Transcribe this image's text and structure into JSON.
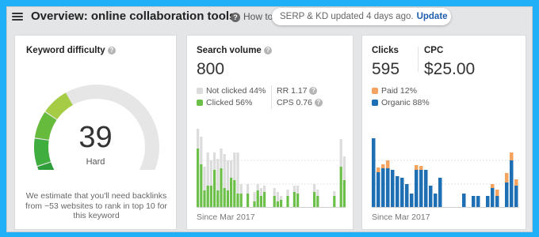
{
  "header": {
    "title": "Overview: online collaboration tools",
    "how_to": "How to",
    "help_glyph": "?",
    "notice_text": "SERP & KD updated 4 days ago.",
    "update_label": "Update"
  },
  "keyword_difficulty": {
    "title": "Keyword difficulty",
    "value": "39",
    "value_fraction": 0.39,
    "label": "Hard",
    "description": "We estimate that you'll need backlinks from ~53 websites to rank in top 10 for this keyword"
  },
  "search_volume": {
    "title": "Search volume",
    "value": "800",
    "legend_not_clicked": "Not clicked 44%",
    "legend_clicked": "Clicked 56%",
    "rr": "RR 1.17",
    "cps": "CPS 0.76",
    "since": "Since Mar 2017"
  },
  "clicks": {
    "title": "Clicks",
    "value": "595",
    "cpc_title": "CPC",
    "cpc_value": "$25.00",
    "legend_paid": "Paid 12%",
    "legend_organic": "Organic 88%",
    "since": "Since Mar 2017"
  },
  "colors": {
    "background": "#1fb0f7",
    "clicked": "#6cc04a",
    "not_clicked": "#dcdcdc",
    "organic": "#1f6fb5",
    "paid": "#f4a460",
    "kd_gauge_fill": "#3fae3f"
  },
  "chart_data": [
    {
      "type": "bar",
      "series": [
        {
          "name": "Clicked",
          "values": [
            0.75,
            0.55,
            0.22,
            0.28,
            0.28,
            0.48,
            0.22,
            0.5,
            0.25,
            0.22,
            0.38,
            0.35,
            0.18,
            0.18,
            0.0,
            0.18,
            0.0,
            0.08,
            0.22,
            0.15,
            0.2,
            0.0,
            0.0,
            0.15,
            0.08,
            0.1,
            0.0,
            0.15,
            0.0,
            0.2,
            0.18,
            0.0,
            0.0,
            0.0,
            0.0,
            0.2,
            0.15,
            0.0,
            0.0,
            0.0,
            0.0,
            0.15,
            0.0,
            0.52,
            0.35
          ]
        },
        {
          "name": "Not clicked",
          "values": [
            0.25,
            0.35,
            0.3,
            0.42,
            0.32,
            0.22,
            0.4,
            0.25,
            0.43,
            0.38,
            0.22,
            0.35,
            0.52,
            0.12,
            0.0,
            0.12,
            0.0,
            0.12,
            0.08,
            0.1,
            0.08,
            0.0,
            0.0,
            0.1,
            0.12,
            0.05,
            0.0,
            0.08,
            0.0,
            0.08,
            0.1,
            0.0,
            0.0,
            0.0,
            0.0,
            0.1,
            0.08,
            0.0,
            0.0,
            0.0,
            0.0,
            0.06,
            0.0,
            0.35,
            0.3
          ]
        }
      ]
    },
    {
      "type": "bar",
      "series": [
        {
          "name": "Organic",
          "values": [
            0.88,
            0.45,
            0.5,
            0.5,
            0.48,
            0.4,
            0.38,
            0.3,
            0.18,
            0.48,
            0.48,
            0.48,
            0.28,
            0.18,
            0.38,
            0.0,
            0.0,
            0.0,
            0.0,
            0.18,
            0.0,
            0.15,
            0.15,
            0.0,
            0.15,
            0.25,
            0.15,
            0.0,
            0.32,
            0.6,
            0.28
          ]
        },
        {
          "name": "Paid",
          "values": [
            0.0,
            0.06,
            0.05,
            0.1,
            0.0,
            0.0,
            0.0,
            0.0,
            0.0,
            0.06,
            0.05,
            0.0,
            0.0,
            0.0,
            0.0,
            0.0,
            0.0,
            0.0,
            0.0,
            0.0,
            0.0,
            0.0,
            0.0,
            0.0,
            0.0,
            0.05,
            0.08,
            0.0,
            0.12,
            0.1,
            0.08
          ]
        }
      ]
    }
  ]
}
